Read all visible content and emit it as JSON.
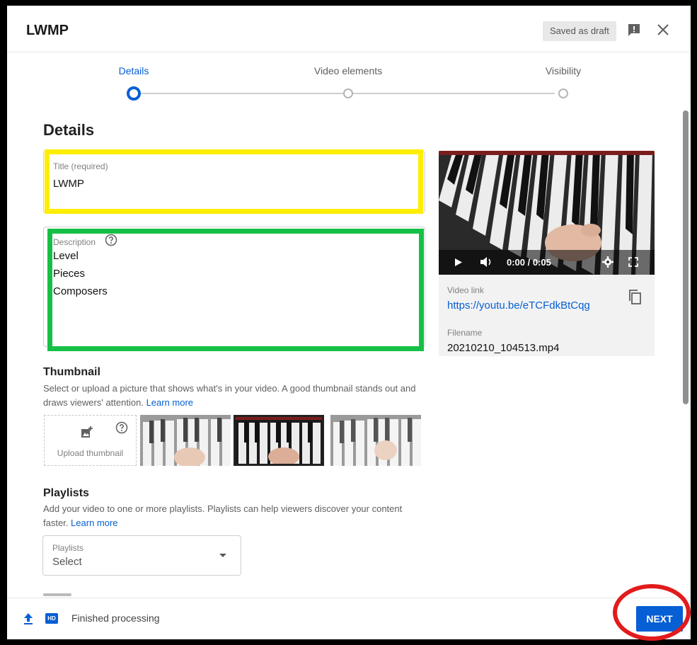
{
  "header": {
    "title": "LWMP",
    "draft_status": "Saved as draft",
    "icons": [
      "feedback-icon",
      "close-icon"
    ]
  },
  "stepper": {
    "steps": [
      {
        "label": "Details",
        "active": true
      },
      {
        "label": "Video elements",
        "active": false
      },
      {
        "label": "Visibility",
        "active": false
      }
    ]
  },
  "details": {
    "heading": "Details",
    "title_field": {
      "label": "Title (required)",
      "value": "LWMP"
    },
    "description_field": {
      "label": "Description",
      "lines": [
        "Level",
        "Pieces",
        "Composers"
      ]
    }
  },
  "video": {
    "time": "0:00 / 0:05",
    "link_label": "Video link",
    "link": "https://youtu.be/eTCFdkBtCqg",
    "filename_label": "Filename",
    "filename": "20210210_104513.mp4"
  },
  "thumbnail": {
    "heading": "Thumbnail",
    "description": "Select or upload a picture that shows what's in your video. A good thumbnail stands out and draws viewers' attention.",
    "learn_more": "Learn more",
    "upload_label": "Upload thumbnail"
  },
  "playlists": {
    "heading": "Playlists",
    "description": "Add your video to one or more playlists. Playlists can help viewers discover your content faster.",
    "learn_more": "Learn more",
    "select_label": "Playlists",
    "select_value": "Select"
  },
  "footer": {
    "hd_badge": "HD",
    "status": "Finished processing",
    "next_label": "NEXT"
  },
  "colors": {
    "accent": "#065fd4",
    "highlight_title": "#ffee00",
    "highlight_description": "#16c046",
    "highlight_next": "#e21b1b"
  }
}
